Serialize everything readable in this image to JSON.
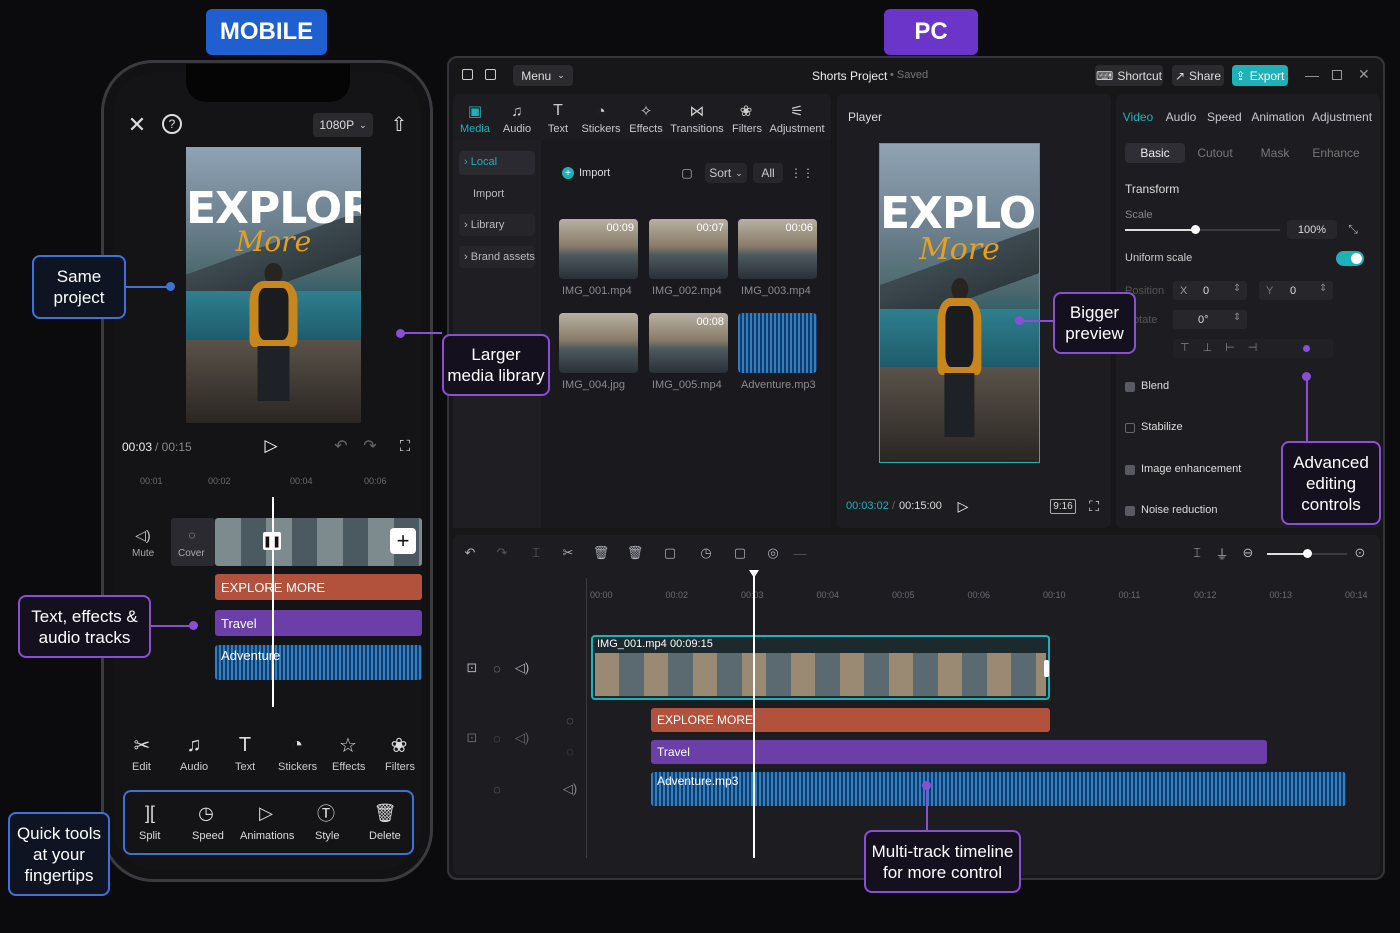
{
  "labels": {
    "mobile": "MOBILE",
    "pc": "PC"
  },
  "callouts": {
    "same_project": "Same\nproject",
    "larger_library": "Larger\nmedia library",
    "text_effects": "Text, effects &\naudio tracks",
    "quick_tools": "Quick tools\nat your\nfingertips",
    "bigger_preview": "Bigger\npreview",
    "advanced": "Advanced\nediting\ncontrols",
    "multitrack": "Multi-track timeline\nfor more control"
  },
  "poster": {
    "title": "EXPLORE",
    "subtitle": "More"
  },
  "mobile": {
    "resolution": "1080P",
    "time_current": "00:03",
    "time_total": "/ 00:15",
    "ruler": [
      "00:01",
      "00:02",
      "00:04",
      "00:06"
    ],
    "side_tools": [
      "Mute",
      "Cover"
    ],
    "tracks": {
      "text": "EXPLORE MORE",
      "travel": "Travel",
      "audio": "Adventure"
    },
    "tools": [
      "Edit",
      "Audio",
      "Text",
      "Stickers",
      "Effects",
      "Filters"
    ],
    "quick": [
      "Split",
      "Speed",
      "Animations",
      "Style",
      "Delete"
    ]
  },
  "pc": {
    "menu": "Menu",
    "project": "Shorts Project",
    "saved": "• Saved",
    "shortcut": "Shortcut",
    "share": "Share",
    "export": "Export",
    "toolbar": [
      "Media",
      "Audio",
      "Text",
      "Stickers",
      "Effects",
      "Transitions",
      "Filters",
      "Adjustment"
    ],
    "sidebar": [
      "Local",
      "Import",
      "Library",
      "Brand assets"
    ],
    "import_btn": "Import",
    "sort": "Sort",
    "all": "All",
    "media": [
      {
        "name": "IMG_001.mp4",
        "dur": "00:09"
      },
      {
        "name": "IMG_002.mp4",
        "dur": "00:07"
      },
      {
        "name": "IMG_003.mp4",
        "dur": "00:06"
      },
      {
        "name": "IMG_004.jpg",
        "dur": ""
      },
      {
        "name": "IMG_005.mp4",
        "dur": "00:08"
      },
      {
        "name": "Adventure.mp3",
        "dur": ""
      }
    ],
    "player": {
      "title": "Player",
      "time_current": "00:03:02",
      "time_total": "00:15:00",
      "ratio": "9:16"
    },
    "props": {
      "tabs": [
        "Video",
        "Audio",
        "Speed",
        "Animation",
        "Adjustment"
      ],
      "subtabs": [
        "Basic",
        "Cutout",
        "Mask",
        "Enhance"
      ],
      "transform": "Transform",
      "scale": "Scale",
      "scale_value": "100%",
      "scale_level": 0.45,
      "uniform": "Uniform scale",
      "position": "Position",
      "x_label": "X",
      "x_value": "0",
      "y_label": "Y",
      "y_value": "0",
      "rotate": "Rotate",
      "rotate_value": "0°",
      "options": [
        "Blend",
        "Stabilize",
        "Image enhancement",
        "Noise reduction"
      ]
    },
    "timeline": {
      "ruler": [
        "00:00",
        "00:02",
        "00:03",
        "00:04",
        "00:05",
        "00:06",
        "00:10",
        "00:11",
        "00:12",
        "00:13",
        "00:14"
      ],
      "clip": "IMG_001.mp4",
      "clip_dur": "00:09:15",
      "text": "EXPLORE MORE",
      "travel": "Travel",
      "audio": "Adventure.mp3",
      "zoom_level": 0.5
    }
  }
}
